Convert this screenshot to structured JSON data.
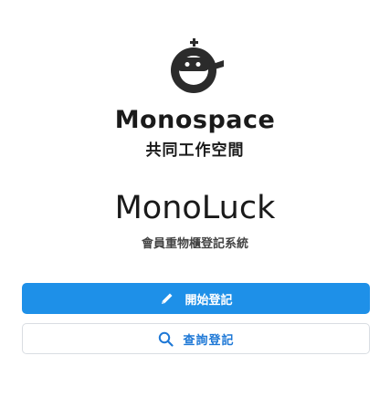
{
  "brand": {
    "name": "Monospace",
    "subtitle": "共同工作空間"
  },
  "app": {
    "title": "MonoLuck",
    "subtitle": "會員重物櫃登記系統"
  },
  "actions": {
    "register_label": "開始登記",
    "search_label": "查詢登記"
  },
  "colors": {
    "primary": "#1e90e8",
    "secondary_text": "#1e78d6",
    "border": "#d9dde2"
  },
  "icons": {
    "logo": "monospace-logo",
    "register": "pencil-icon",
    "search": "search-icon"
  }
}
